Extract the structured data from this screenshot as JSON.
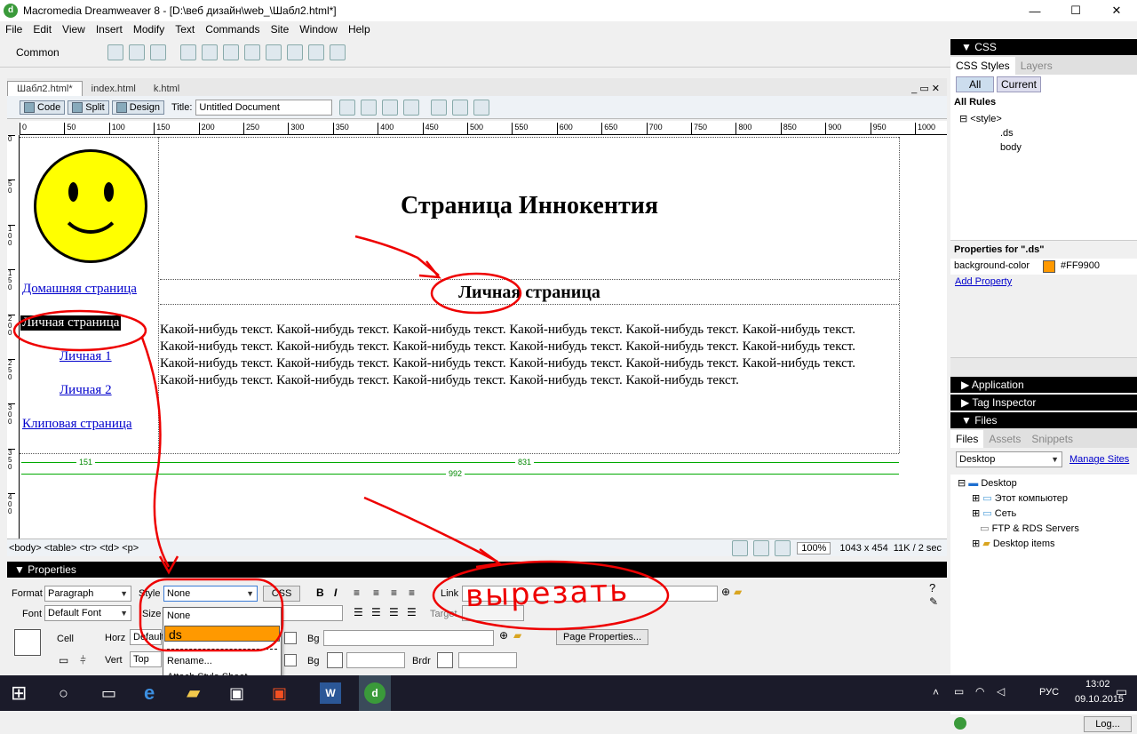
{
  "window": {
    "title": "Macromedia Dreamweaver 8 - [D:\\веб дизайн\\web_\\Шабл2.html*]",
    "minimize": "—",
    "maximize": "☐",
    "close": "✕"
  },
  "menu": [
    "File",
    "Edit",
    "View",
    "Insert",
    "Modify",
    "Text",
    "Commands",
    "Site",
    "Window",
    "Help"
  ],
  "insert_bar": {
    "category": "Common"
  },
  "doc_tabs": [
    "Шабл2.html*",
    "index.html",
    "k.html"
  ],
  "doc_toolbar": {
    "code": "Code",
    "split": "Split",
    "design": "Design",
    "title_label": "Title:",
    "title_value": "Untitled Document"
  },
  "ruler_ticks": [
    "0",
    "50",
    "100",
    "150",
    "200",
    "250",
    "300",
    "350",
    "400",
    "450",
    "500",
    "550",
    "600",
    "650",
    "700",
    "750",
    "800",
    "850",
    "900",
    "950",
    "1000"
  ],
  "vruler_ticks": [
    "0",
    "5 0",
    "1 0 0",
    "1 5 0",
    "2 0 0",
    "2 5 0",
    "3 0 0",
    "3 5 0",
    "4 0 0"
  ],
  "page": {
    "heading": "Страница Иннокентия",
    "subheading": "Личная страница",
    "nav": [
      "Домашняя страница",
      "Личная страница",
      "Личная 1",
      "Личная 2",
      "Клиповая страница"
    ],
    "paragraph": "Какой-нибудь текст. Какой-нибудь текст. Какой-нибудь текст. Какой-нибудь текст. Какой-нибудь текст. Какой-нибудь текст. Какой-нибудь текст. Какой-нибудь текст. Какой-нибудь текст. Какой-нибудь текст. Какой-нибудь текст. Какой-нибудь текст. Какой-нибудь текст. Какой-нибудь текст. Какой-нибудь текст. Какой-нибудь текст. Какой-нибудь текст. Какой-нибудь текст. Какой-нибудь текст. Какой-нибудь текст. Какой-нибудь текст. Какой-нибудь текст. Какой-нибудь текст.",
    "width_left": "151",
    "width_right": "831",
    "width_total": "992"
  },
  "statusbar": {
    "tags": "<body> <table> <tr> <td> <p>",
    "zoom": "100%",
    "size": "1043 x 454",
    "weight": "11K / 2 sec"
  },
  "properties": {
    "header": "Properties",
    "format_label": "Format",
    "format_value": "Paragraph",
    "style_label": "Style",
    "style_value": "None",
    "css_button": "CSS",
    "link_label": "Link",
    "font_label": "Font",
    "font_value": "Default Font",
    "size_label": "Size",
    "target_label": "Target",
    "cell_label": "Cell",
    "horz_label": "Horz",
    "horz_value": "Default",
    "vert_label": "Vert",
    "vert_value": "Top",
    "bg_label": "Bg",
    "bg2_label": "Bg",
    "brdr_label": "Brdr",
    "page_props": "Page Properties...",
    "bold": "B",
    "italic": "I"
  },
  "style_dropdown": [
    "None",
    "ds",
    "Rename...",
    "Attach Style Sheet..."
  ],
  "annotation": "вырезать",
  "css_panel": {
    "header": "CSS",
    "tabs": [
      "CSS Styles",
      "Layers"
    ],
    "modes": [
      "All",
      "Current"
    ],
    "all_rules": "All Rules",
    "rules": [
      "<style>",
      ".ds",
      "body"
    ],
    "props_title": "Properties for \".ds\"",
    "prop_name": "background-color",
    "prop_value": "#FF9900",
    "add_prop": "Add Property"
  },
  "application_panel": "Application",
  "tag_inspector": "Tag Inspector",
  "files_panel": {
    "header": "Files",
    "tabs": [
      "Files",
      "Assets",
      "Snippets"
    ],
    "location": "Desktop",
    "manage": "Manage Sites",
    "tree": [
      "Desktop",
      "Этот компьютер",
      "Сеть",
      "FTP & RDS Servers",
      "Desktop items"
    ],
    "log": "Log..."
  },
  "taskbar": {
    "time": "13:02",
    "date": "09.10.2015",
    "lang": "РУС"
  },
  "colors": {
    "accent_orange": "#FF9900",
    "swatch": "#FF9900",
    "link": "#0000CC",
    "annotation": "#E00000"
  }
}
